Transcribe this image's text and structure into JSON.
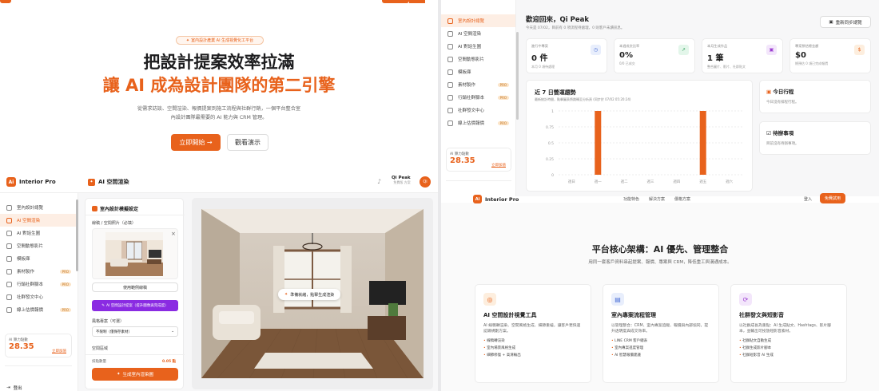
{
  "landing": {
    "badge": "室內設計產業 AI 生成視覺化工平台",
    "headline1": "把設計提案效率拉滿",
    "headline2": "讓 AI 成為設計團隊的第二引擎",
    "sub1": "從需求訪談、空間渲染、報價提案到施工流程與社群行銷，一個平台整合室",
    "sub2": "內設計團隊最需要的 AI 能力與 CRM 管理。",
    "cta_primary": "立即開始 →",
    "cta_secondary": "觀看演示"
  },
  "dashboard": {
    "brand": "Interior Pro",
    "greeting": "歡迎回來，Qi Peak",
    "greeting_sub": "今天是 07/02，目前有 0 項流程待處理，0 則客戶未讀訊息。",
    "sync_button": "重新同步總覽",
    "sidebar": [
      {
        "label": "室內設計總覽",
        "pro": false,
        "active": true
      },
      {
        "label": "AI 空間渲染",
        "pro": false,
        "active": false
      },
      {
        "label": "AI 對話生圖",
        "pro": false,
        "active": false
      },
      {
        "label": "空間動態影片",
        "pro": false,
        "active": false
      },
      {
        "label": "模板庫",
        "pro": false,
        "active": false
      },
      {
        "label": "素材製作",
        "pro": true,
        "active": false
      },
      {
        "label": "行銷社群腳本",
        "pro": true,
        "active": false
      },
      {
        "label": "社群發文中心",
        "pro": false,
        "active": false
      },
      {
        "label": "線上估價報價",
        "pro": true,
        "active": false
      }
    ],
    "credits_label": "AI 算力點數",
    "credits_value": "28.35",
    "credits_link": "立即加值",
    "stats": [
      {
        "label": "進行中專案",
        "value": "0 件",
        "sub": "本月 0 項待處理"
      },
      {
        "label": "本週成交比率",
        "value": "0%",
        "sub": "0/0 已成交"
      },
      {
        "label": "本月生成作品",
        "value": "1 筆",
        "sub": "整合圖片、影片、社群貼文"
      },
      {
        "label": "專案預估總金額",
        "value": "$0",
        "sub": "總預估 0 項已完成報價"
      }
    ],
    "chart_title": "近 7 日營運趨勢",
    "chart_sub": "最新統計時間，點擊圖表將跳轉至分析頁 (同步於 07/02 05:20:24)",
    "today_title": "今日行程",
    "today_sub": "今日沒有排程行程。",
    "todo_title": "待辦事項",
    "todo_sub": "目前沒有待辦事項。"
  },
  "chart_data": {
    "type": "bar",
    "categories": [
      "週日",
      "週一",
      "週二",
      "週三",
      "週四",
      "週五",
      "週六"
    ],
    "values": [
      0,
      1,
      0,
      0,
      0,
      1,
      0
    ],
    "ylim": [
      0,
      1
    ],
    "yticks": [
      "1",
      "0.75",
      "0.5",
      "0.25",
      "0"
    ],
    "color": "#e8621c"
  },
  "render": {
    "brand": "Interior Pro",
    "page_title": "AI 空間渲染",
    "user_name": "Qi Peak",
    "user_plan": "免費版 方案",
    "avatar": "Qi",
    "panel_title": "室內設計模擬設定",
    "upload_label": "線稿 / 空間照片（必填）",
    "sample_button": "使用範例線稿",
    "analyze_button": "AI 空間設計提案（提升圖像與完成度）",
    "style_label": "風格專案（可選）",
    "style_value": "不限制（僅保存素材）",
    "space_label": "空間區域",
    "cost_label": "扣點數量",
    "cost_value": "0.05 點",
    "generate_button": "生成室內渲染圖",
    "preview_hint": "準備就緒，點擊生成渲染",
    "sidebar": [
      {
        "label": "室內設計總覽",
        "pro": false,
        "active": false
      },
      {
        "label": "AI 空間渲染",
        "pro": false,
        "active": true
      },
      {
        "label": "AI 對話生圖",
        "pro": false,
        "active": false
      },
      {
        "label": "空間動態影片",
        "pro": false,
        "active": false
      },
      {
        "label": "模板庫",
        "pro": false,
        "active": false
      },
      {
        "label": "素材製作",
        "pro": true,
        "active": false
      },
      {
        "label": "行銷社群腳本",
        "pro": true,
        "active": false
      },
      {
        "label": "社群發文中心",
        "pro": false,
        "active": false
      },
      {
        "label": "線上估價報價",
        "pro": true,
        "active": false
      }
    ],
    "credits_label": "AI 算力點數",
    "credits_value": "28.35",
    "credits_link": "立即加值",
    "logout": "登出"
  },
  "features": {
    "brand": "Interior Pro",
    "nav": [
      "功能特色",
      "解決方案",
      "價格方案"
    ],
    "login": "登入",
    "signup": "免費試用",
    "title": "平台核心架構：AI 優先、管理整合",
    "subtitle": "用同一套客戶資料串起提案、報價、專案與 CRM，降低重工與溝通成本。",
    "cards": [
      {
        "title": "AI 空間設計視覺工具",
        "desc": "AI 線稿轉渲染、空間風格生成、細節重繪，讓客戶更快速認識規劃方案。",
        "items": [
          "線稿轉渲染",
          "室內場景風格生成",
          "細節修復 + 高清輸出"
        ]
      },
      {
        "title": "室內專案流程管理",
        "desc": "以管理整合：CRM、室內專案追蹤、報價與內部協同，提升透明度與成交效率。",
        "items": [
          "LINE CRM 客戶總表",
          "室內專案進度管理",
          "AI 智慧報價建議"
        ]
      },
      {
        "title": "社群發文與短影音",
        "desc": "以社群成長為重點：AI 生成貼文、Hashtags、影片腳本，並輔出可投放短影音素材。",
        "items": [
          "社群貼文自動生成",
          "社群生成影片腳本",
          "社群短影音 AI 生成"
        ]
      }
    ]
  }
}
